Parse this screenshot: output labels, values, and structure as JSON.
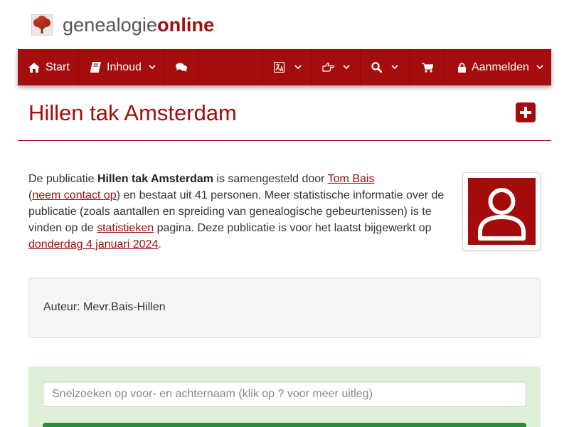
{
  "brand": {
    "part1": "genealogie",
    "part2": "online",
    "logo_icon": "tree-logo-icon"
  },
  "nav": {
    "start_label": "Start",
    "inhoud_label": "Inhoud",
    "aanmelden_label": "Aanmelden",
    "icons": [
      "home-icon",
      "book-icon",
      "comments-icon",
      "language-icon",
      "hand-pointer-icon",
      "search-icon",
      "cart-icon",
      "lock-icon"
    ]
  },
  "page": {
    "title": "Hillen tak Amsterdam"
  },
  "intro": {
    "t1": "De publicatie ",
    "pub_name": "Hillen tak Amsterdam",
    "t2": " is samengesteld door ",
    "author_link": "Tom Bais",
    "t3": " (",
    "contact_link": "neem contact op",
    "t4": ") en bestaat uit 41 personen. Meer statistische informatie over de publicatie (zoals aantallen en spreiding van genealogische gebeurtenissen) is te vinden op de ",
    "stats_link": "statistieken",
    "t5": " pagina. Deze publicatie is voor het laatst bijgewerkt op ",
    "date_link": "donderdag 4 januari 2024",
    "t6": "."
  },
  "author": {
    "text": "Auteur: Mevr.Bais-Hillen"
  },
  "search": {
    "placeholder": "Snelzoeken op voor- en achternaam (klik op ? voor meer uitleg)"
  },
  "colors": {
    "brand_red": "#a40c0c",
    "nav_red": "#a50c0c",
    "panel_green": "#dff0d8",
    "button_green": "#2e8b3a"
  }
}
